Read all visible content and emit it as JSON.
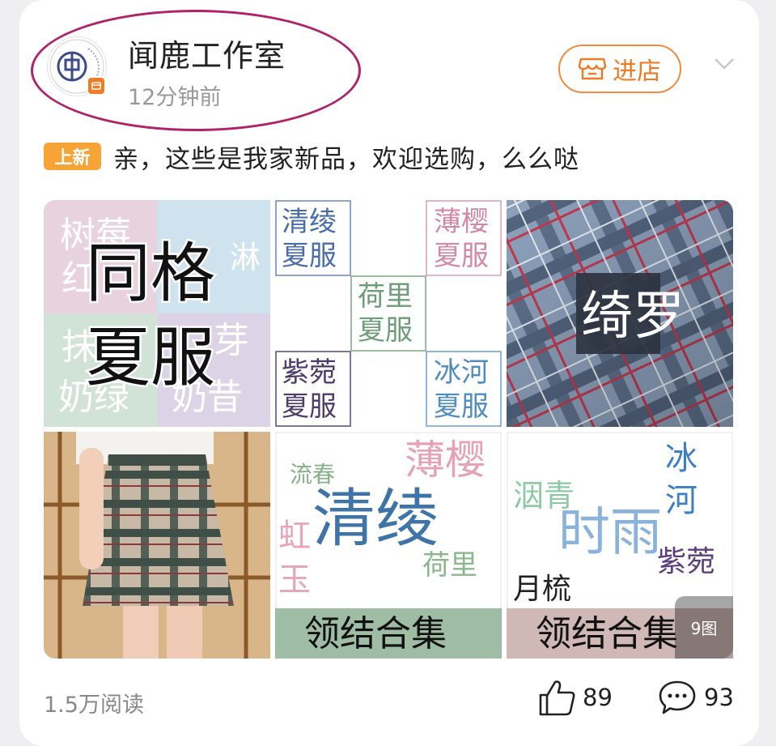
{
  "post": {
    "author": "闻鹿工作室",
    "time": "12分钟前",
    "enter_shop_label": "进店",
    "tag": "上新",
    "text": "亲，这些是我家新品，欢迎选购，么么哒",
    "image_count": "9图",
    "reads": "1.5万阅读",
    "likes": "89",
    "comments": "93"
  },
  "images": {
    "t1": {
      "big": [
        "同格",
        "夏服"
      ],
      "bg_words": [
        "树莓",
        "红",
        "淋",
        "抹",
        "芽",
        "奶绿",
        "奶昔"
      ]
    },
    "t2": {
      "cells": [
        "清绫",
        "夏服",
        "薄樱",
        "夏服",
        "荷里",
        "夏服",
        "紫菀",
        "夏服",
        "冰河",
        "夏服"
      ]
    },
    "t3": {
      "label": "绮罗"
    },
    "t5": {
      "words": [
        "流春",
        "薄樱",
        "清绫",
        "虹",
        "玉",
        "荷里"
      ],
      "footer": "领结合集"
    },
    "t6": {
      "words": [
        "冰",
        "河",
        "洇青",
        "时雨",
        "紫菀",
        "月梳"
      ],
      "footer": "领结合集"
    }
  },
  "colors": {
    "accent": "#f08b40",
    "highlight": "#b0236b",
    "tag": "#f7a437"
  },
  "icons": [
    "shop-badge-icon",
    "store-icon",
    "chevron-down-icon",
    "thumb-up-icon",
    "comment-icon"
  ]
}
